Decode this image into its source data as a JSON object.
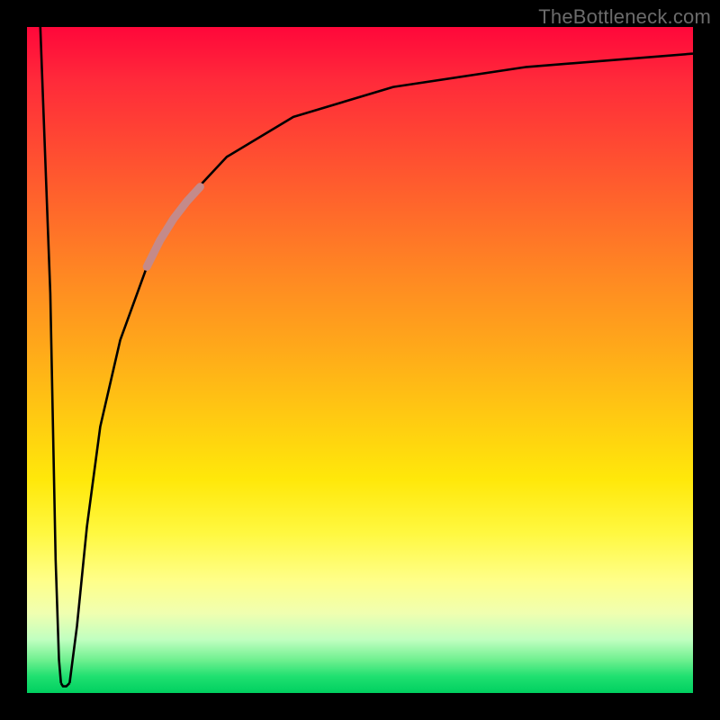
{
  "attribution": "TheBottleneck.com",
  "chart_data": {
    "type": "line",
    "title": "",
    "xlabel": "",
    "ylabel": "",
    "xlim": [
      0,
      100
    ],
    "ylim": [
      0,
      100
    ],
    "background_gradient": {
      "orientation": "vertical",
      "stops": [
        {
          "y": 100,
          "color": "#ff073a"
        },
        {
          "y": 70,
          "color": "#ff7a22"
        },
        {
          "y": 45,
          "color": "#ffd010"
        },
        {
          "y": 25,
          "color": "#ffff60"
        },
        {
          "y": 10,
          "color": "#c0ffb0"
        },
        {
          "y": 0,
          "color": "#00d060"
        }
      ]
    },
    "series": [
      {
        "name": "left-spike-down",
        "stroke": "#000000",
        "stroke_width": 2.6,
        "x": [
          2.0,
          3.5,
          4.3,
          4.8,
          5.1
        ],
        "y": [
          100,
          60,
          20,
          5,
          1.5
        ]
      },
      {
        "name": "dip-bottom",
        "stroke": "#000000",
        "stroke_width": 2.6,
        "x": [
          5.1,
          5.4,
          5.9,
          6.4
        ],
        "y": [
          1.5,
          1.0,
          1.0,
          1.5
        ]
      },
      {
        "name": "rise-curve",
        "stroke": "#000000",
        "stroke_width": 2.6,
        "x": [
          6.4,
          7.5,
          9,
          11,
          14,
          18,
          23,
          30,
          40,
          55,
          75,
          100
        ],
        "y": [
          1.5,
          10,
          25,
          40,
          53,
          64,
          73,
          80.5,
          86.5,
          91,
          94,
          96
        ]
      },
      {
        "name": "highlight-segment",
        "stroke": "#c48a8a",
        "stroke_width": 9,
        "linecap": "round",
        "x": [
          18,
          20,
          22,
          24,
          26
        ],
        "y": [
          64,
          68,
          71.2,
          73.8,
          76
        ]
      }
    ]
  }
}
